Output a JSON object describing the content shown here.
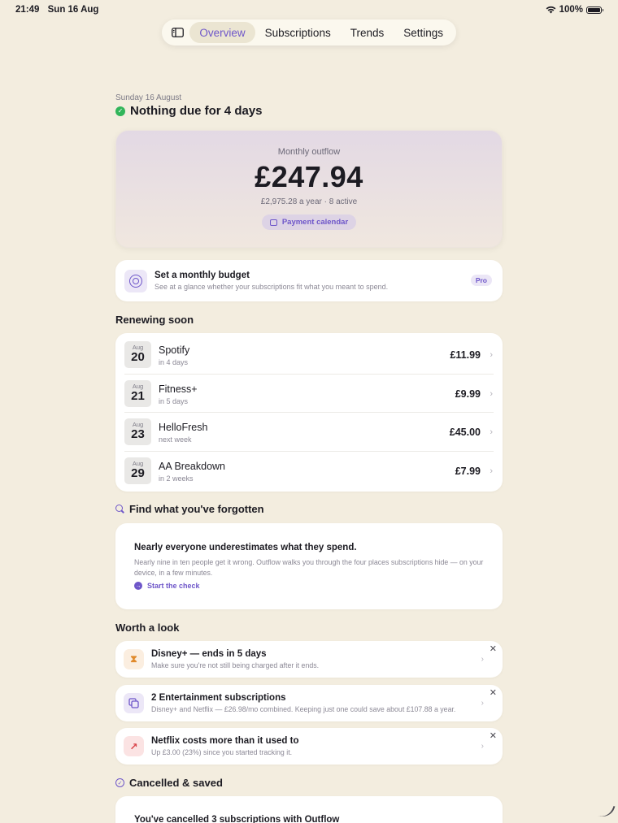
{
  "status": {
    "time": "21:49",
    "date": "Sun 16 Aug",
    "battery": "100%"
  },
  "nav": {
    "tabs": [
      "Overview",
      "Subscriptions",
      "Trends",
      "Settings"
    ],
    "active": "Overview"
  },
  "header": {
    "date": "Sunday 16 August",
    "due": "Nothing due for 4 days"
  },
  "outflow": {
    "label": "Monthly outflow",
    "amount": "£247.94",
    "sub": "£2,975.28 a year · 8 active",
    "calendar_button": "Payment calendar"
  },
  "budget": {
    "title": "Set a monthly budget",
    "subtitle": "See at a glance whether your subscriptions fit what you meant to spend.",
    "badge": "Pro"
  },
  "renewing": {
    "title": "Renewing soon",
    "items": [
      {
        "month": "Aug",
        "day": "20",
        "name": "Spotify",
        "when": "in 4 days",
        "price": "£11.99"
      },
      {
        "month": "Aug",
        "day": "21",
        "name": "Fitness+",
        "when": "in 5 days",
        "price": "£9.99"
      },
      {
        "month": "Aug",
        "day": "23",
        "name": "HelloFresh",
        "when": "next week",
        "price": "£45.00"
      },
      {
        "month": "Aug",
        "day": "29",
        "name": "AA Breakdown",
        "when": "in 2 weeks",
        "price": "£7.99"
      }
    ]
  },
  "forgotten": {
    "title": "Find what you've forgotten",
    "heading": "Nearly everyone underestimates what they spend.",
    "body": "Nearly nine in ten people get it wrong. Outflow walks you through the four places subscriptions hide — on your device, in a few minutes.",
    "link": "Start the check"
  },
  "worth_a_look": {
    "title": "Worth a look",
    "items": [
      {
        "icon": "hourglass-icon",
        "title": "Disney+ — ends in 5 days",
        "subtitle": "Make sure you're not still being charged after it ends."
      },
      {
        "icon": "copy-icon",
        "title": "2 Entertainment subscriptions",
        "subtitle": "Disney+ and Netflix — £26.98/mo combined. Keeping just one could save about £107.88 a year."
      },
      {
        "icon": "trend-up-icon",
        "title": "Netflix costs more than it used to",
        "subtitle": "Up £3.00 (23%) since you started tracking it."
      }
    ]
  },
  "cancelled": {
    "title": "Cancelled & saved",
    "text": "You've cancelled 3 subscriptions with Outflow"
  },
  "colors": {
    "accent": "#6e56c9",
    "background": "#f3eddf",
    "success": "#31b55a"
  }
}
